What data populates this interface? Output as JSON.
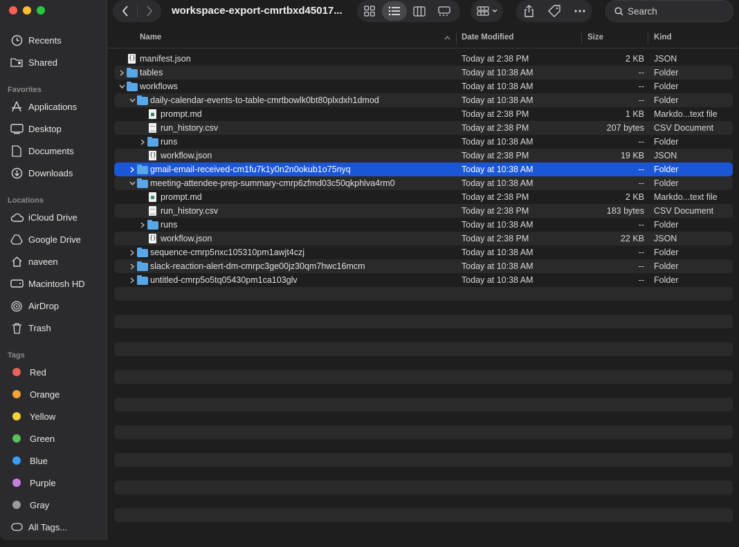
{
  "window": {
    "title": "workspace-export-cmrtbxd45017...",
    "search_placeholder": "Search"
  },
  "sidebar": {
    "favorites_title": "Favorites",
    "locations_title": "Locations",
    "tags_title": "Tags",
    "top_items": [
      {
        "label": "Recents",
        "icon": "clock-icon"
      },
      {
        "label": "Shared",
        "icon": "shared-folder-icon"
      }
    ],
    "favorites": [
      {
        "label": "Applications",
        "icon": "applications-icon"
      },
      {
        "label": "Desktop",
        "icon": "desktop-icon"
      },
      {
        "label": "Documents",
        "icon": "document-icon"
      },
      {
        "label": "Downloads",
        "icon": "download-icon"
      }
    ],
    "locations": [
      {
        "label": "iCloud Drive",
        "icon": "cloud-icon"
      },
      {
        "label": "Google Drive",
        "icon": "google-drive-icon"
      },
      {
        "label": "naveen",
        "icon": "home-icon"
      },
      {
        "label": "Macintosh HD",
        "icon": "disk-icon"
      },
      {
        "label": "AirDrop",
        "icon": "airdrop-icon"
      },
      {
        "label": "Trash",
        "icon": "trash-icon"
      }
    ],
    "tags": [
      {
        "label": "Red",
        "color": "#ec5f5a"
      },
      {
        "label": "Orange",
        "color": "#f2a33a"
      },
      {
        "label": "Yellow",
        "color": "#f5d234"
      },
      {
        "label": "Green",
        "color": "#5ac05e"
      },
      {
        "label": "Blue",
        "color": "#3a9cf6"
      },
      {
        "label": "Purple",
        "color": "#c67ee6"
      },
      {
        "label": "Gray",
        "color": "#9a9a9e"
      }
    ],
    "all_tags": "All Tags..."
  },
  "columns": {
    "name": "Name",
    "date": "Date Modified",
    "size": "Size",
    "kind": "Kind"
  },
  "files": [
    {
      "name": "manifest.json",
      "date": "Today at 2:38 PM",
      "size": "2 KB",
      "kind": "JSON",
      "level": 0,
      "type": "json",
      "disclosure": "none"
    },
    {
      "name": "tables",
      "date": "Today at 10:38 AM",
      "size": "--",
      "kind": "Folder",
      "level": 0,
      "type": "folder",
      "disclosure": "collapsed"
    },
    {
      "name": "workflows",
      "date": "Today at 10:38 AM",
      "size": "--",
      "kind": "Folder",
      "level": 0,
      "type": "folder",
      "disclosure": "expanded"
    },
    {
      "name": "daily-calendar-events-to-table-cmrtbowlk0bt80plxdxh1dmod",
      "date": "Today at 10:38 AM",
      "size": "--",
      "kind": "Folder",
      "level": 1,
      "type": "folder",
      "disclosure": "expanded"
    },
    {
      "name": "prompt.md",
      "date": "Today at 2:38 PM",
      "size": "1 KB",
      "kind": "Markdo...text file",
      "level": 2,
      "type": "md",
      "disclosure": "none"
    },
    {
      "name": "run_history.csv",
      "date": "Today at 2:38 PM",
      "size": "207 bytes",
      "kind": "CSV Document",
      "level": 2,
      "type": "csv",
      "disclosure": "none"
    },
    {
      "name": "runs",
      "date": "Today at 10:38 AM",
      "size": "--",
      "kind": "Folder",
      "level": 2,
      "type": "folder",
      "disclosure": "collapsed"
    },
    {
      "name": "workflow.json",
      "date": "Today at 2:38 PM",
      "size": "19 KB",
      "kind": "JSON",
      "level": 2,
      "type": "json",
      "disclosure": "none"
    },
    {
      "name": "gmail-email-received-cm1fu7k1y0n2n0okub1o75nyq",
      "date": "Today at 10:38 AM",
      "size": "--",
      "kind": "Folder",
      "level": 1,
      "type": "folder",
      "disclosure": "collapsed",
      "selected": true
    },
    {
      "name": "meeting-attendee-prep-summary-cmrp6zfmd03c50qkphlva4rm0",
      "date": "Today at 10:38 AM",
      "size": "--",
      "kind": "Folder",
      "level": 1,
      "type": "folder",
      "disclosure": "expanded"
    },
    {
      "name": "prompt.md",
      "date": "Today at 2:38 PM",
      "size": "2 KB",
      "kind": "Markdo...text file",
      "level": 2,
      "type": "md",
      "disclosure": "none"
    },
    {
      "name": "run_history.csv",
      "date": "Today at 2:38 PM",
      "size": "183 bytes",
      "kind": "CSV Document",
      "level": 2,
      "type": "csv",
      "disclosure": "none"
    },
    {
      "name": "runs",
      "date": "Today at 10:38 AM",
      "size": "--",
      "kind": "Folder",
      "level": 2,
      "type": "folder",
      "disclosure": "collapsed"
    },
    {
      "name": "workflow.json",
      "date": "Today at 2:38 PM",
      "size": "22 KB",
      "kind": "JSON",
      "level": 2,
      "type": "json",
      "disclosure": "none"
    },
    {
      "name": "sequence-cmrp5nxc105310pm1awjt4czj",
      "date": "Today at 10:38 AM",
      "size": "--",
      "kind": "Folder",
      "level": 1,
      "type": "folder",
      "disclosure": "collapsed"
    },
    {
      "name": "slack-reaction-alert-dm-cmrpc3ge00jz30qm7hwc16mcm",
      "date": "Today at 10:38 AM",
      "size": "--",
      "kind": "Folder",
      "level": 1,
      "type": "folder",
      "disclosure": "collapsed"
    },
    {
      "name": "untitled-cmrp5o5tq05430pm1ca103glv",
      "date": "Today at 10:38 AM",
      "size": "--",
      "kind": "Folder",
      "level": 1,
      "type": "folder",
      "disclosure": "collapsed"
    }
  ],
  "accent_color": "#1b56d6"
}
